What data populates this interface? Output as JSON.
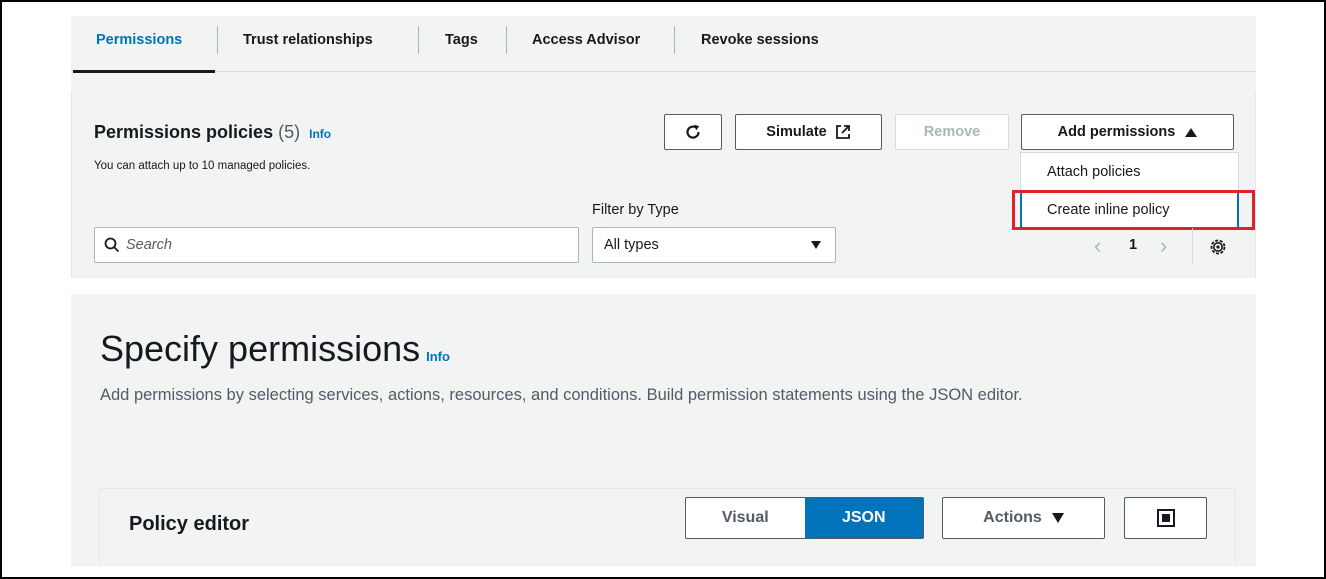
{
  "tabs": [
    {
      "label": "Permissions",
      "active": true
    },
    {
      "label": "Trust relationships",
      "active": false
    },
    {
      "label": "Tags",
      "active": false
    },
    {
      "label": "Access Advisor",
      "active": false
    },
    {
      "label": "Revoke sessions",
      "active": false
    }
  ],
  "policies": {
    "title": "Permissions policies",
    "count": "(5)",
    "info": "Info",
    "subtitle": "You can attach up to 10 managed policies."
  },
  "toolbar": {
    "refresh_icon": "refresh-icon",
    "simulate_label": "Simulate",
    "external_icon": "external-link-icon",
    "remove_label": "Remove",
    "add_permissions_label": "Add permissions"
  },
  "add_menu": {
    "items": [
      "Attach policies",
      "Create inline policy"
    ],
    "highlighted": "Create inline policy"
  },
  "filter": {
    "search_placeholder": "Search",
    "type_label": "Filter by Type",
    "type_value": "All types"
  },
  "pagination": {
    "current_page": "1",
    "prev": "‹",
    "next": "›"
  },
  "specify": {
    "title": "Specify permissions",
    "info": "Info",
    "description": "Add permissions by selecting services, actions, resources, and conditions. Build permission statements using the JSON editor."
  },
  "policy_editor": {
    "title": "Policy editor",
    "modes": [
      "Visual",
      "JSON"
    ],
    "active_mode": "JSON",
    "actions_label": "Actions"
  },
  "colors": {
    "accent": "#0073bb",
    "highlight": "#e0222a",
    "panel_bg": "#f2f3f3"
  }
}
